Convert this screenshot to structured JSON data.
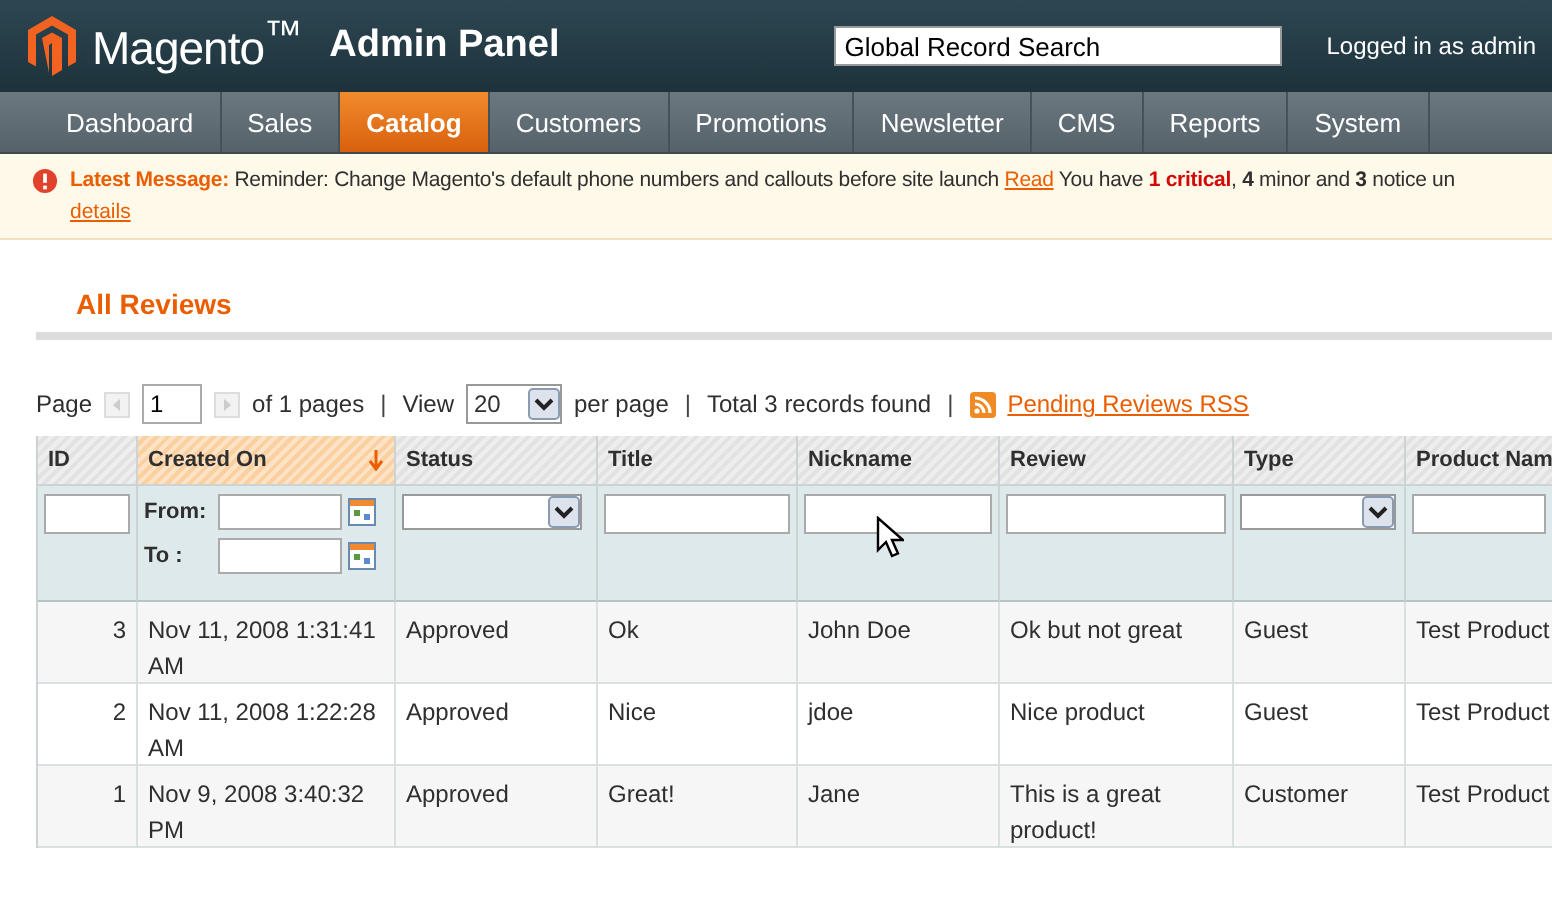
{
  "header": {
    "logo": "Magento$^{™}$",
    "logo_suffix": "Admin Panel",
    "search": {
      "value": "Global Record Search"
    },
    "user": "Logged in as admin"
  },
  "nav": [
    {
      "label": "Dashboard",
      "selected": false
    },
    {
      "label": "Sales",
      "selected": false
    },
    {
      "label": "Catalog",
      "selected": true
    },
    {
      "label": "Customers",
      "selected": false
    },
    {
      "label": "Promotions",
      "selected": false
    },
    {
      "label": "Newsletter",
      "selected": false
    },
    {
      "label": "CMS",
      "selected": false
    },
    {
      "label": "Reports",
      "selected": false
    },
    {
      "label": "System",
      "selected": false
    }
  ],
  "message": {
    "label": "Latest Message:",
    "text": "Reminder: Change Magento's default phone numbers and callouts before site launch",
    "link": "Read",
    "parts": [
      {
        "kind": "plain",
        "text": "You have"
      },
      {
        "kind": "critical",
        "text": "1 critical"
      },
      {
        "kind": "plain",
        "text": ","
      },
      {
        "kind": "bold",
        "text": "4"
      },
      {
        "kind": "plain",
        "text": "minor and"
      },
      {
        "kind": "bold",
        "text": "3"
      },
      {
        "kind": "plain",
        "text": "notice un"
      }
    ],
    "details": "details"
  },
  "page_title": "All Reviews",
  "pager": {
    "page_label": "Page",
    "page": "1",
    "of_pages": "of 1 pages",
    "view_label": "View",
    "per_page": "20",
    "per_page_label": "per page",
    "total": "Total 3 records found",
    "rss_link": "Pending Reviews RSS",
    "separators": [
      "|",
      "|",
      "|"
    ]
  },
  "table": {
    "columns": [
      {
        "label": "ID",
        "sorted": false,
        "kind": "text"
      },
      {
        "label": "Created On",
        "sorted": true,
        "kind": "date"
      },
      {
        "label": "Status",
        "sorted": false,
        "kind": "select"
      },
      {
        "label": "Title",
        "sorted": false,
        "kind": "text"
      },
      {
        "label": "Nickname",
        "sorted": false,
        "kind": "text"
      },
      {
        "label": "Review",
        "sorted": false,
        "kind": "text"
      },
      {
        "label": "Type",
        "sorted": false,
        "kind": "select"
      },
      {
        "label": "Product Nam",
        "sorted": false,
        "kind": "text"
      }
    ],
    "date_filter": {
      "from": "From:",
      "to": "To :"
    },
    "rows": [
      [
        "3",
        "Nov 11, 2008 1:31:41 AM",
        "Approved",
        "Ok",
        "John Doe",
        "Ok but not great",
        "Guest",
        "Test Product"
      ],
      [
        "2",
        "Nov 11, 2008 1:22:28 AM",
        "Approved",
        "Nice",
        "jdoe",
        "Nice product",
        "Guest",
        "Test Product"
      ],
      [
        "1",
        "Nov 9, 2008 3:40:32 PM",
        "Approved",
        "Great!",
        "Jane",
        "This is a great product!",
        "Customer",
        "Test Product"
      ]
    ]
  }
}
